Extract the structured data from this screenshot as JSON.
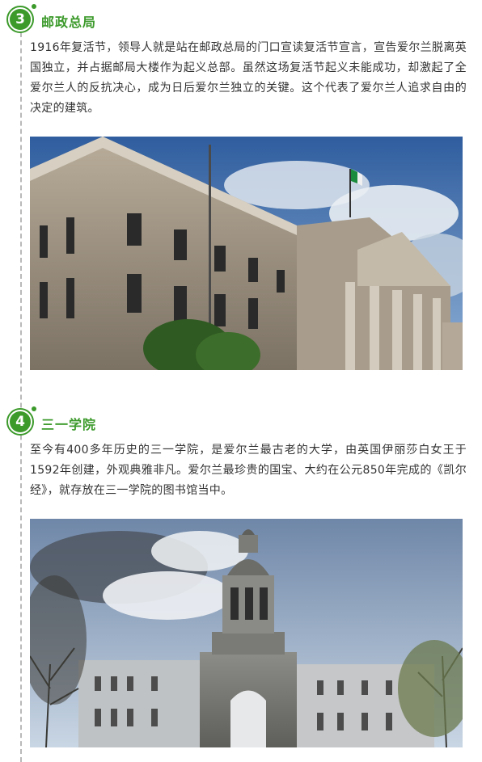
{
  "sections": [
    {
      "number": "3",
      "title": "邮政总局",
      "paragraph": "1916年复活节，领导人就是站在邮政总局的门口宣读复活节宣言，宣告爱尔兰脱离英国独立，并占据邮局大楼作为起义总部。虽然这场复活节起义未能成功，却激起了全爱尔兰人的反抗决心，成为日后爱尔兰独立的关键。这个代表了爱尔兰人追求自由的决定的建筑。",
      "photo": "gpo-building-photo"
    },
    {
      "number": "4",
      "title": "三一学院",
      "paragraph": "至今有400多年历史的三一学院，是爱尔兰最古老的大学，由英国伊丽莎白女王于1592年创建，外观典雅非凡。爱尔兰最珍贵的国宝、大约在公元850年完成的《凯尔经》，就存放在三一学院的图书馆当中。",
      "photo": "trinity-college-photo"
    }
  ],
  "colors": {
    "accent": "#3c9a2b",
    "text": "#333333"
  }
}
